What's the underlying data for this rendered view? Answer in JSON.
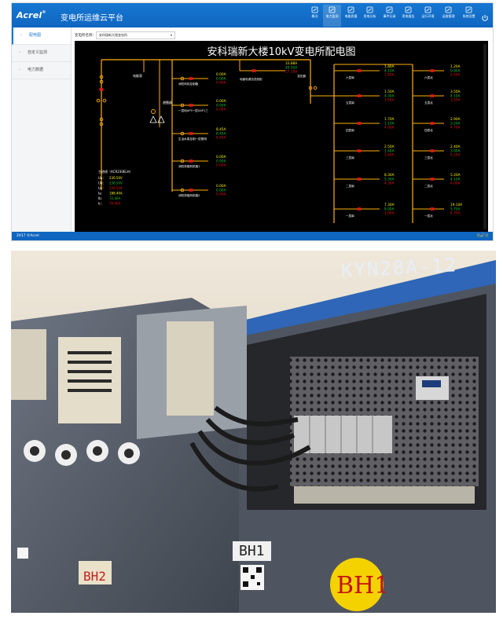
{
  "app": {
    "logo": "Acrel",
    "trademark": "®",
    "title": "变电所运维云平台",
    "power_icon": "power-icon"
  },
  "nav": [
    {
      "label": "概况",
      "icon": "home-icon"
    },
    {
      "label": "电力监测",
      "icon": "monitor-icon",
      "active": true
    },
    {
      "label": "电能质量",
      "icon": "quality-icon"
    },
    {
      "label": "用电分析",
      "icon": "analysis-icon"
    },
    {
      "label": "事件记录",
      "icon": "event-icon"
    },
    {
      "label": "用电报告",
      "icon": "report-icon"
    },
    {
      "label": "运行环境",
      "icon": "environment-icon"
    },
    {
      "label": "运维管理",
      "icon": "maintenance-icon"
    },
    {
      "label": "系统设置",
      "icon": "settings-icon"
    }
  ],
  "sidebar": [
    {
      "label": "配电图",
      "active": true
    },
    {
      "label": "自定义监测"
    },
    {
      "label": "电力数据"
    }
  ],
  "filter": {
    "label": "变电所名称：",
    "selected": "安科瑞新大楼变电所"
  },
  "diagram": {
    "title": "安科瑞新大楼10kV变电所配电图",
    "colors": {
      "bus": "#ffb000",
      "red": "#e01818",
      "green": "#19c43a",
      "yellow": "#f2f200",
      "white": "#ffffff"
    },
    "left_labels": [
      "电能表",
      "避雷器"
    ],
    "main_meter": {
      "heading": "主进线（ACR230ELH）",
      "rows": [
        {
          "label": "Ua：",
          "value": "236.50V"
        },
        {
          "label": "Ub：",
          "value": "236.50V"
        },
        {
          "label": "Uc：",
          "value": "236.50V"
        },
        {
          "label": "Ia：",
          "value": "188.40A"
        },
        {
          "label": "Ib：",
          "value": "72.40A"
        },
        {
          "label": "Ic：",
          "value": "70.40A"
        }
      ]
    },
    "feeders": [
      {
        "name": "消防风机控制箱",
        "readings": [
          "0.00A",
          "0.00A",
          "0.00A"
        ]
      },
      {
        "name": "一层地AP3一层XAP1三",
        "readings": [
          "0.00A",
          "0.00A",
          "0.00A"
        ]
      },
      {
        "name": "生活水泵控制一层照明",
        "readings": [
          "8.45A",
          "8.45A",
          "8.45A"
        ]
      },
      {
        "name": "消防排烟风机箱1",
        "readings": [
          "0.00A",
          "0.00A",
          "0.00A"
        ]
      },
      {
        "name": "消防排烟风机箱2",
        "readings": [
          "0.00A",
          "0.00A",
          "0.00A"
        ]
      }
    ],
    "tie": {
      "name": "地面电源总进线柜",
      "readings": [
        "33.88A",
        "40.35A",
        "27.10A"
      ]
    },
    "transformer_label": "变压器",
    "floors_left": [
      {
        "name": "六层南",
        "readings": [
          "1.80A",
          "4.10A",
          "1.80A"
        ]
      },
      {
        "name": "五层南",
        "readings": [
          "1.50A",
          "4.30A",
          "1.60A"
        ]
      },
      {
        "name": "四层南",
        "readings": [
          "1.70A",
          "1.10A",
          "4.00A"
        ]
      },
      {
        "name": "三层南",
        "readings": [
          "2.50A",
          "1.40A",
          "1.60A"
        ]
      },
      {
        "name": "二层南",
        "readings": [
          "8.30A",
          "5.30A",
          "4.30A"
        ]
      },
      {
        "name": "一层南",
        "readings": [
          "7.30A",
          "8.00A",
          "1.00A"
        ]
      }
    ],
    "floors_right": [
      {
        "name": "六层北",
        "readings": [
          "1.20A",
          "0.80A",
          "0.50A"
        ]
      },
      {
        "name": "五层北",
        "readings": [
          "3.50A",
          "4.10A",
          "3.50A"
        ]
      },
      {
        "name": "四层北",
        "readings": [
          "2.90A",
          "3.20A",
          "4.70A"
        ]
      },
      {
        "name": "三层北",
        "readings": [
          "2.40A",
          "3.00A",
          "4.20A"
        ]
      },
      {
        "name": "二层北",
        "readings": [
          "5.20A",
          "4.10A",
          "4.60A"
        ]
      },
      {
        "name": "一层北",
        "readings": [
          "19.10A",
          "5.70A",
          "4.70A"
        ]
      }
    ]
  },
  "footer": {
    "copyright": "2017 ©Acrel",
    "audio_icon": "((🔊))"
  },
  "photo": {
    "cabinet_model": "KYN28A-12",
    "label_bh2": "BH2",
    "label_bh1_card": "BH1",
    "label_bh1_big": "BH1"
  }
}
